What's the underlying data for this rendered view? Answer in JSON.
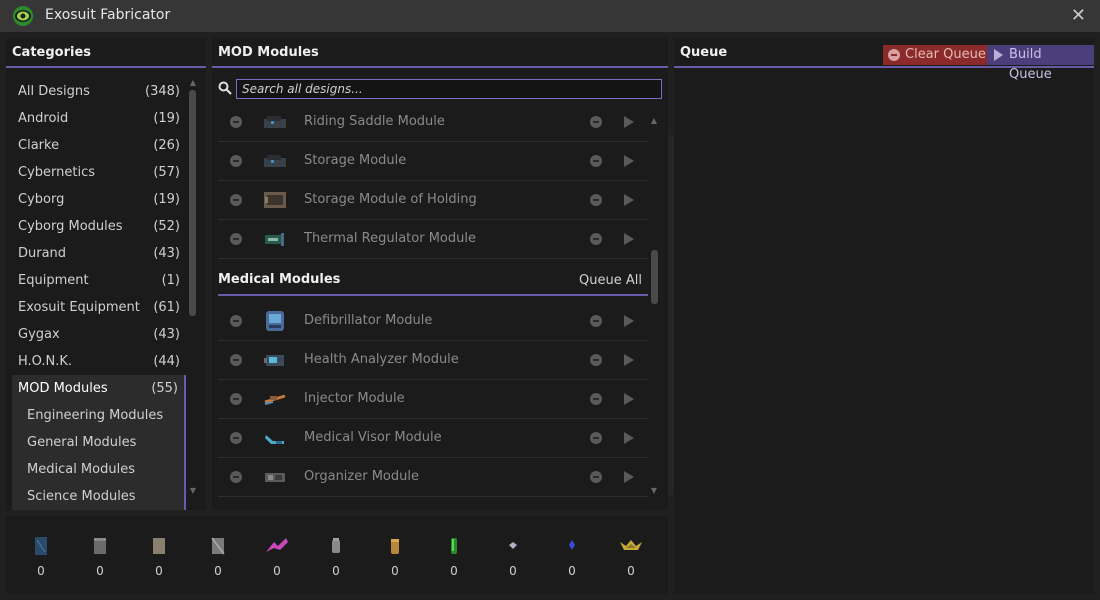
{
  "window": {
    "title": "Exosuit Fabricator"
  },
  "categories": {
    "title": "Categories",
    "items": [
      {
        "label": "All Designs",
        "count": "(348)"
      },
      {
        "label": "Android",
        "count": "(19)"
      },
      {
        "label": "Clarke",
        "count": "(26)"
      },
      {
        "label": "Cybernetics",
        "count": "(57)"
      },
      {
        "label": "Cyborg",
        "count": "(19)"
      },
      {
        "label": "Cyborg Modules",
        "count": "(52)"
      },
      {
        "label": "Durand",
        "count": "(43)"
      },
      {
        "label": "Equipment",
        "count": "(1)"
      },
      {
        "label": "Exosuit Equipment",
        "count": "(61)"
      },
      {
        "label": "Gygax",
        "count": "(43)"
      },
      {
        "label": "H.O.N.K.",
        "count": "(44)"
      },
      {
        "label": "MOD Modules",
        "count": "(55)"
      }
    ],
    "subitems": [
      {
        "label": "Engineering Modules"
      },
      {
        "label": "General Modules"
      },
      {
        "label": "Medical Modules"
      },
      {
        "label": "Science Modules"
      }
    ]
  },
  "modules": {
    "title": "MOD Modules",
    "search_placeholder": "Search all designs...",
    "rows_top": [
      {
        "name": "Riding Saddle Module",
        "icon": "saddle-module-icon"
      },
      {
        "name": "Storage Module",
        "icon": "storage-module-icon"
      },
      {
        "name": "Storage Module of Holding",
        "icon": "holding-module-icon"
      },
      {
        "name": "Thermal Regulator Module",
        "icon": "thermal-module-icon"
      }
    ],
    "section": {
      "title": "Medical Modules",
      "queue_all": "Queue All"
    },
    "rows_medical": [
      {
        "name": "Defibrillator Module",
        "icon": "defib-module-icon"
      },
      {
        "name": "Health Analyzer Module",
        "icon": "analyzer-module-icon"
      },
      {
        "name": "Injector Module",
        "icon": "injector-module-icon"
      },
      {
        "name": "Medical Visor Module",
        "icon": "visor-module-icon"
      },
      {
        "name": "Organizer Module",
        "icon": "organizer-module-icon"
      }
    ]
  },
  "queue": {
    "title": "Queue",
    "clear_label": "Clear Queue",
    "build_label": "Build Queue"
  },
  "materials": [
    {
      "icon": "glass-sheet-icon",
      "count": "0",
      "color": "#3a6a8a"
    },
    {
      "icon": "iron-sheet-icon",
      "count": "0",
      "color": "#8a8a8a"
    },
    {
      "icon": "sandstone-icon",
      "count": "0",
      "color": "#a89a86"
    },
    {
      "icon": "plasteel-icon",
      "count": "0",
      "color": "#9a9a9a"
    },
    {
      "icon": "bananium-icon",
      "count": "0",
      "color": "#c848b8"
    },
    {
      "icon": "titanium-icon",
      "count": "0",
      "color": "#a0a0a0"
    },
    {
      "icon": "gold-bar-icon",
      "count": "0",
      "color": "#c89a48"
    },
    {
      "icon": "uranium-icon",
      "count": "0",
      "color": "#3aa83a"
    },
    {
      "icon": "diamond-icon",
      "count": "0",
      "color": "#b8b8c8"
    },
    {
      "icon": "bluespace-icon",
      "count": "0",
      "color": "#3a5ad8"
    },
    {
      "icon": "plasma-icon",
      "count": "0",
      "color": "#d8c838"
    }
  ]
}
